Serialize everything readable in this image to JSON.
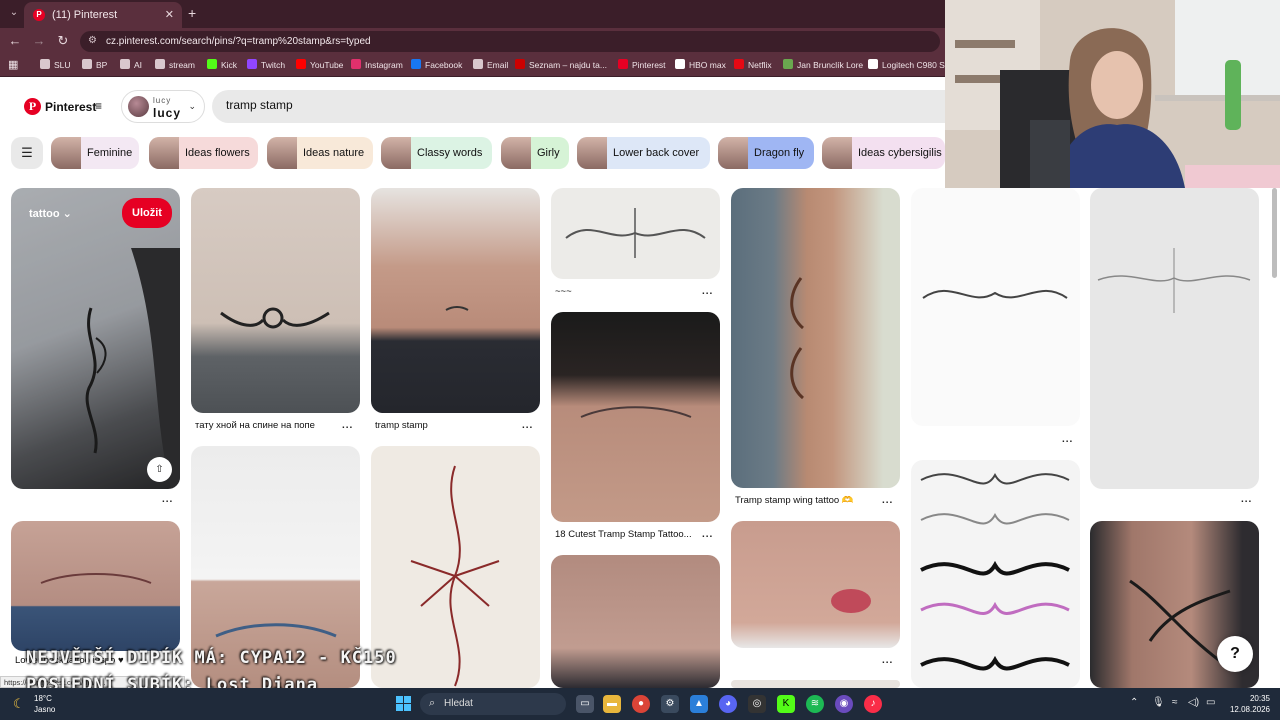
{
  "browser": {
    "tab_title": "(11) Pinterest",
    "tab_close": "✕",
    "new_tab": "+",
    "url": "cz.pinterest.com/search/pins/?q=tramp%20stamp&rs=typed",
    "nav": {
      "back": "←",
      "forward": "→",
      "reload": "↻"
    },
    "bookmarks": [
      {
        "label": "SLU",
        "color": "#d9c7cd"
      },
      {
        "label": "BP",
        "color": "#d9c7cd"
      },
      {
        "label": "AI",
        "color": "#d9c7cd"
      },
      {
        "label": "stream",
        "color": "#d9c7cd"
      },
      {
        "label": "Kick",
        "color": "#53fc18"
      },
      {
        "label": "Twitch",
        "color": "#9146ff"
      },
      {
        "label": "YouTube",
        "color": "#ff0000"
      },
      {
        "label": "Instagram",
        "color": "#e1306c"
      },
      {
        "label": "Facebook",
        "color": "#1877f2"
      },
      {
        "label": "Email",
        "color": "#d9c7cd"
      },
      {
        "label": "Seznam – najdu ta...",
        "color": "#cc0000"
      },
      {
        "label": "Pinterest",
        "color": "#e60023"
      },
      {
        "label": "HBO max",
        "color": "#ffffff"
      },
      {
        "label": "Netflix",
        "color": "#e50914"
      },
      {
        "label": "Jan Brunclík Lore",
        "color": "#6aa84f"
      },
      {
        "label": "Logitech C980 Stre...",
        "color": "#ffffff"
      }
    ]
  },
  "pinterest": {
    "logo": "P",
    "brand": "Pinterest",
    "menu": "≡",
    "profile_small": "lucy",
    "profile_big": "lucy",
    "search_value": "tramp stamp",
    "accent": "#e60023",
    "chips": [
      {
        "label": "Feminine",
        "bg": "#f3e8f3"
      },
      {
        "label": "Ideas flowers",
        "bg": "#f6dada"
      },
      {
        "label": "Ideas nature",
        "bg": "#f8e9d9"
      },
      {
        "label": "Classy words",
        "bg": "#dcf3e4"
      },
      {
        "label": "Girly",
        "bg": "#d6f3d6"
      },
      {
        "label": "Lower back cover",
        "bg": "#dde7f7"
      },
      {
        "label": "Dragon fly",
        "bg": "#9fb6f3"
      },
      {
        "label": "Ideas cybersigilis",
        "bg": "#f3e0f0"
      }
    ],
    "hovered_pin": {
      "board": "tattoo",
      "save": "Uložit",
      "share": "⇧"
    },
    "captions": [
      "тату хной на спине на попе",
      "tramp stamp",
      "~~~",
      "18 Cutest Tramp Stamp Tattoo...",
      "Tramp stamp wing tattoo 🫶",
      "Lower back tattoo inspo ♥"
    ],
    "more": "...",
    "help": "?"
  },
  "overlay": {
    "line1": "NEJVĚTŠÍ DIPÍK MÁ: CYPA12 - KČ150",
    "line2": "POSLEDNÍ SUBÍK: Lost_Diana"
  },
  "status_url": "https://cz.pinterest.com/pin/4...",
  "taskbar": {
    "temp": "18°C",
    "weather": "Jasno",
    "search": "Hledat",
    "time": "20:35",
    "date": "12.08.2026"
  }
}
